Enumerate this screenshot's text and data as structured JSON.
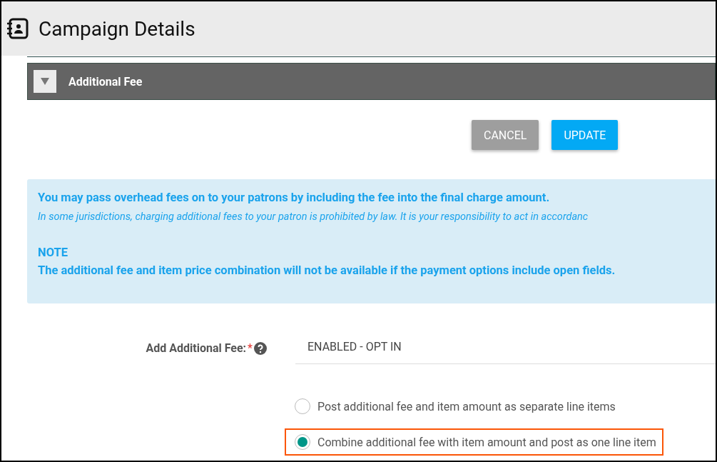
{
  "header": {
    "title": "Campaign Details"
  },
  "section": {
    "title": "Additional Fee",
    "expanded": true
  },
  "buttons": [
    {
      "label": "CANCEL",
      "kind": "secondary"
    },
    {
      "label": "UPDATE",
      "kind": "primary"
    }
  ],
  "info": {
    "lead": "You may pass overhead fees on to your patrons by including the fee into the final charge amount.",
    "disclaimer": "In some jurisdictions, charging additional fees to your patron is prohibited by law. It is your responsibility to act in accordanc",
    "note_title": "NOTE",
    "note": "The additional fee and item price combination will not be available if the payment options include open fields."
  },
  "field": {
    "label": "Add Additional Fee:",
    "required_mark": "*",
    "value": "ENABLED - OPT IN"
  },
  "options": [
    {
      "label": "Post additional fee and item amount as separate line items",
      "selected": false,
      "highlighted": false
    },
    {
      "label": "Combine additional fee with item amount and post as one line item",
      "selected": true,
      "highlighted": true
    }
  ]
}
